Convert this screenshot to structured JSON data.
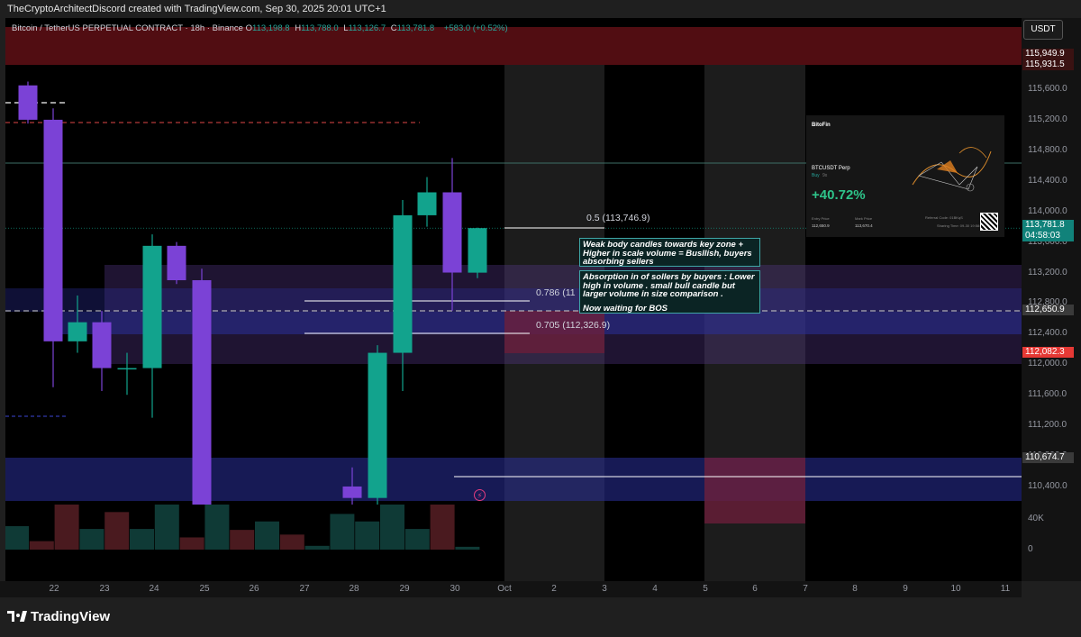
{
  "attribution": "TheCryptoArchitectDiscord created with TradingView.com, Sep 30, 2025 20:01 UTC+1",
  "legend": {
    "symbol": "Bitcoin / TetherUS PERPETUAL CONTRACT · 18h · Binance",
    "open_key": "O",
    "open": "113,198.8",
    "high_key": "H",
    "high": "113,788.0",
    "low_key": "L",
    "low": "113,126.7",
    "close_key": "C",
    "close": "113,781.8",
    "change": "+583.0 (+0.52%)"
  },
  "currency": "USDT",
  "price_tags": {
    "top1": "115,949.9",
    "top2": "115,931.5",
    "last_price": "113,781.8",
    "countdown": "04:58:03",
    "tag_112650": "112,650.9",
    "tag_112082": "112,082.3",
    "tag_110674": "110,674.7"
  },
  "colors": {
    "bull": "#12a38d",
    "bear": "#7b42d6",
    "zone_purple": "#5a3a8f",
    "zone_blue": "#2a2f9a",
    "supply_red": "#5a0e14",
    "last_price_tag": "#11827a",
    "red_tag": "#e53935"
  },
  "fib_labels": {
    "fib_05": "0.5 (113,746.9)",
    "fib_0786": "0.786 (11",
    "fib_0705": "0.705 (112,326.9)"
  },
  "notes": {
    "note1": "Weak body candles towards key zone + Higher in scale volume = Busllish, buyers absorbing sellers",
    "note2": "Absorption in of sollers by buyers : Lower high in volume . small bull candle but larger volume in size comparison .",
    "note3": "Now waiting for BOS"
  },
  "pnl_card": {
    "brand": "BitoFin",
    "symbol": "BTCUSDT Perp",
    "side": "Buy",
    "side2": "9x",
    "pnl": "+40.72%",
    "entry_label": "Entry Price",
    "entry": "112,650.9",
    "mark_label": "Mark Price",
    "mark": "113,670.4",
    "ref_label": "Referral Code: 01BKqS",
    "time_label": "Sharing Time: 09-30 19:58:54"
  },
  "volume_axis": {
    "label_40k": "40K",
    "label_0": "0"
  },
  "footer": {
    "brand": "TradingView"
  },
  "chart_data": {
    "type": "candlestick",
    "title": "Bitcoin / TetherUS PERPETUAL CONTRACT · 18h · Binance",
    "interval": "18h",
    "x_labels": [
      "22",
      "23",
      "24",
      "25",
      "26",
      "27",
      "28",
      "29",
      "30",
      "Oct",
      "2",
      "3",
      "4",
      "5",
      "6",
      "7",
      "8",
      "9",
      "10",
      "11"
    ],
    "y_ticks": [
      115600,
      115200,
      114800,
      114400,
      114000,
      113600,
      113200,
      112800,
      112400,
      112000,
      111600,
      111200,
      110800,
      110400
    ],
    "y_tick_labels": [
      "115,600.0",
      "115,200.0",
      "114,800.0",
      "114,400.0",
      "114,000.0",
      "113,600.0",
      "113,200.0",
      "112,800.0",
      "112,400.0",
      "112,000.0",
      "111,600.0",
      "111,200.0",
      "110,800.0",
      "110,400.0"
    ],
    "y_range": [
      110050,
      116450
    ],
    "candles": [
      {
        "o": 115650,
        "h": 115700,
        "l": 115150,
        "c": 115200
      },
      {
        "o": 115200,
        "h": 115350,
        "l": 111700,
        "c": 112300
      },
      {
        "o": 112300,
        "h": 112900,
        "l": 112150,
        "c": 112550
      },
      {
        "o": 112550,
        "h": 112700,
        "l": 111650,
        "c": 111950
      },
      {
        "o": 111950,
        "h": 112150,
        "l": 111600,
        "c": 111950
      },
      {
        "o": 111950,
        "h": 113700,
        "l": 111300,
        "c": 113550
      },
      {
        "o": 113550,
        "h": 113600,
        "l": 113050,
        "c": 113100
      },
      {
        "o": 113100,
        "h": 113250,
        "l": 108700,
        "c": 108800
      },
      {
        "o": 110400,
        "h": 110650,
        "l": 110150,
        "c": 110250
      },
      {
        "o": 110250,
        "h": 112250,
        "l": 110050,
        "c": 112150
      },
      {
        "o": 112150,
        "h": 114150,
        "l": 111650,
        "c": 113950
      },
      {
        "o": 113950,
        "h": 114450,
        "l": 113800,
        "c": 114250
      },
      {
        "o": 114250,
        "h": 114700,
        "l": 112700,
        "c": 113200
      },
      {
        "o": 113198.8,
        "h": 113788.0,
        "l": 113126.7,
        "c": 113781.8
      }
    ],
    "volumes": [
      {
        "v": 25000,
        "dir": "up"
      },
      {
        "v": 9000,
        "dir": "down"
      },
      {
        "v": 48000,
        "dir": "down"
      },
      {
        "v": 22000,
        "dir": "up"
      },
      {
        "v": 40000,
        "dir": "down"
      },
      {
        "v": 22000,
        "dir": "up"
      },
      {
        "v": 48000,
        "dir": "up"
      },
      {
        "v": 13000,
        "dir": "down"
      },
      {
        "v": 48000,
        "dir": "up"
      },
      {
        "v": 21000,
        "dir": "down"
      },
      {
        "v": 30000,
        "dir": "up"
      },
      {
        "v": 16000,
        "dir": "down"
      },
      {
        "v": 4000,
        "dir": "up"
      },
      {
        "v": 38000,
        "dir": "up"
      },
      {
        "v": 30000,
        "dir": "up"
      },
      {
        "v": 48000,
        "dir": "up"
      },
      {
        "v": 22000,
        "dir": "up"
      },
      {
        "v": 48000,
        "dir": "down"
      },
      {
        "v": 3000,
        "dir": "up"
      }
    ],
    "levels": {
      "fib_0_5": 113746.9,
      "fib_0_786": 112900,
      "fib_0_705": 112326.9,
      "last_price": 113781.8,
      "level_112650": 112650.9,
      "level_112082": 112082.3,
      "level_110674": 110674.7
    },
    "grid": false
  }
}
